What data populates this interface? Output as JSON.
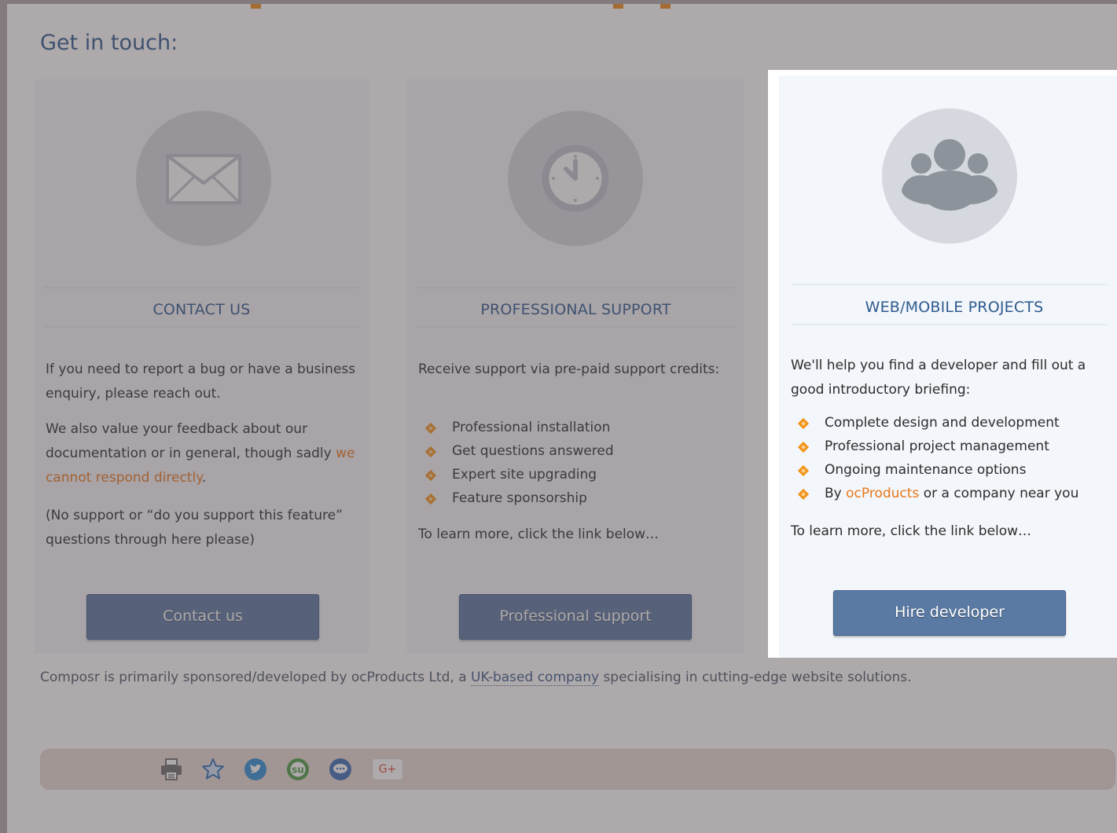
{
  "page": {
    "heading": "Get in touch:",
    "footer_note": {
      "before": "Composr is primarily sponsored/developed by ocProducts Ltd, a ",
      "link": "UK-based company",
      "after": " specialising in cutting-edge website solutions."
    }
  },
  "cards": {
    "contact": {
      "icon": "envelope-icon",
      "title": "CONTACT US",
      "para1": "If you need to report a bug or have a business enquiry, please reach out.",
      "para2_before": "We also value your feedback about our documentation or in general, though sadly ",
      "para2_link": "we cannot respond directly",
      "para2_after": ".",
      "para3": "(No support or “do you support this feature” questions through here please)",
      "button": "Contact us"
    },
    "support": {
      "icon": "clock-icon",
      "title": "PROFESSIONAL SUPPORT",
      "intro": "Receive support via pre-paid support credits:",
      "bullets": [
        "Professional installation",
        "Get questions answered",
        "Expert site upgrading",
        "Feature sponsorship"
      ],
      "learn_more": "To learn more, click the link below…",
      "button": "Professional support"
    },
    "projects": {
      "icon": "group-icon",
      "title": "WEB/MOBILE PROJECTS",
      "intro": "We'll help you find a developer and fill out a good introductory briefing:",
      "bullets": [
        "Complete design and development",
        "Professional project management",
        "Ongoing maintenance options"
      ],
      "bullet4_before": "By ",
      "bullet4_link": "ocProducts",
      "bullet4_after": " or a company near you",
      "learn_more": "To learn more, click the link below…",
      "button": "Hire developer"
    }
  },
  "share_bar": {
    "icons": [
      "print-icon",
      "favorite-star-icon",
      "twitter-icon",
      "stumbleupon-icon",
      "chat-icon",
      "google-plus-icon"
    ],
    "google_plus_label": "G+"
  },
  "colors": {
    "accent_orange": "#ef8c1c",
    "link_orange": "#e8781b",
    "title_blue": "#2e5b8f",
    "button_blue": "#5b7aa3",
    "dim_overlay": "rgba(82,72,76,0.47)"
  }
}
